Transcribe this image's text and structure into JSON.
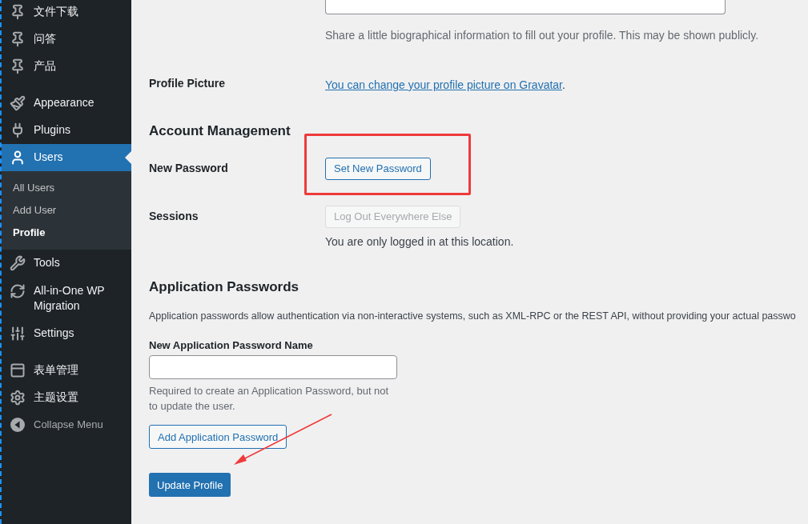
{
  "sidebar": {
    "items": [
      {
        "kind": "item",
        "label": "文件下载",
        "selected": false
      },
      {
        "kind": "item",
        "label": "问答",
        "selected": false
      },
      {
        "kind": "item",
        "label": "产品",
        "selected": false
      },
      {
        "kind": "separator"
      },
      {
        "kind": "item",
        "label": "Appearance",
        "selected": false
      },
      {
        "kind": "item",
        "label": "Plugins",
        "selected": false
      },
      {
        "kind": "item",
        "label": "Users",
        "selected": true,
        "children": [
          {
            "label": "All Users",
            "selected": false
          },
          {
            "label": "Add User",
            "selected": false
          },
          {
            "label": "Profile",
            "selected": true
          }
        ]
      },
      {
        "kind": "item",
        "label": "Tools",
        "selected": false
      },
      {
        "kind": "item",
        "label": "All-in-One WP Migration",
        "selected": false
      },
      {
        "kind": "item",
        "label": "Settings",
        "selected": false
      },
      {
        "kind": "separator"
      },
      {
        "kind": "item",
        "label": "表单管理",
        "selected": false
      },
      {
        "kind": "item",
        "label": "主题设置",
        "selected": false
      }
    ],
    "collapse_label": "Collapse Menu"
  },
  "bio": {
    "description": "Share a little biographical information to fill out your profile. This may be shown publicly."
  },
  "profile_picture": {
    "label": "Profile Picture",
    "link": "You can change your profile picture on Gravatar",
    "suffix": "."
  },
  "account_management": {
    "heading": "Account Management",
    "new_password": {
      "label": "New Password",
      "button": "Set New Password"
    },
    "sessions": {
      "label": "Sessions",
      "button": "Log Out Everywhere Else",
      "button_disabled": true,
      "note": "You are only logged in at this location."
    }
  },
  "application_passwords": {
    "heading": "Application Passwords",
    "description": "Application passwords allow authentication via non-interactive systems, such as XML-RPC or the REST API, without providing your actual passwo",
    "field_label": "New Application Password Name",
    "help": "Required to create an Application Password, but not to update the user.",
    "add_button": "Add Application Password"
  },
  "submit_button": "Update Profile"
}
